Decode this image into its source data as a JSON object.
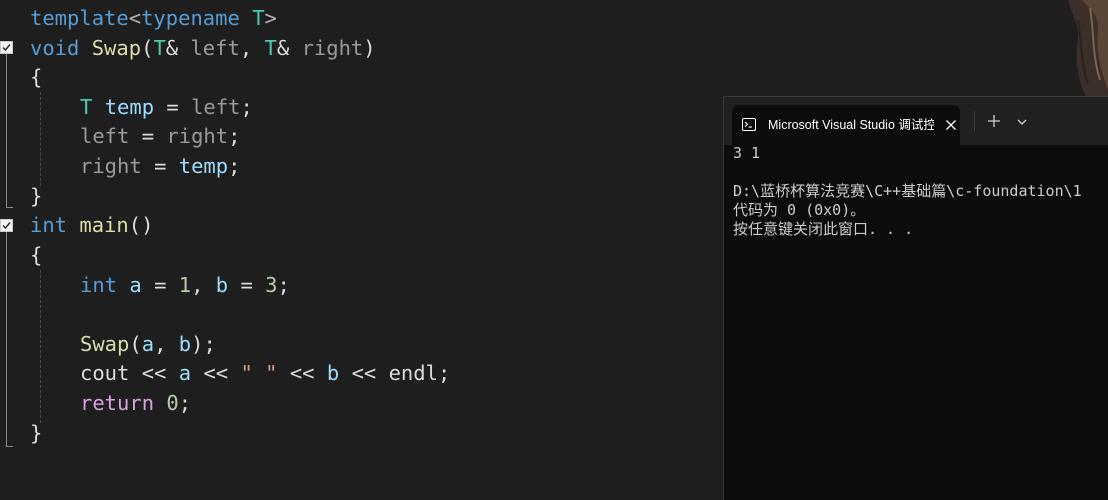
{
  "editor": {
    "lines": {
      "l1": {
        "kw1": "template",
        "lt": "<",
        "kw2": "typename",
        "ty": "T",
        "gt": ">"
      },
      "l2": {
        "kw": "void",
        "fn": "Swap",
        "p1": "(",
        "ty1": "T",
        "amp1": "&",
        "prm1": "left",
        "comma": ",",
        "ty2": "T",
        "amp2": "&",
        "prm2": "right",
        "p2": ")"
      },
      "l3": {
        "brace": "{"
      },
      "l4": {
        "ty": "T",
        "var": "temp",
        "eq": "=",
        "prm": "left",
        "semi": ";"
      },
      "l5": {
        "prm1": "left",
        "eq": "=",
        "prm2": "right",
        "semi": ";"
      },
      "l6": {
        "prm": "right",
        "eq": "=",
        "var": "temp",
        "semi": ";"
      },
      "l7": {
        "brace": "}"
      },
      "l8": {
        "kw": "int",
        "fn": "main",
        "parens": "()"
      },
      "l9": {
        "brace": "{"
      },
      "l10": {
        "kw": "int",
        "v1": "a",
        "eq1": "=",
        "n1": "1",
        "comma": ",",
        "v2": "b",
        "eq2": "=",
        "n2": "3",
        "semi": ";"
      },
      "l12": {
        "fn": "Swap",
        "p1": "(",
        "v1": "a",
        "comma": ",",
        "v2": "b",
        "p2": ")",
        "semi": ";"
      },
      "l13": {
        "id1": "cout",
        "op1": "<<",
        "v1": "a",
        "op2": "<<",
        "str": "\" \"",
        "op3": "<<",
        "v2": "b",
        "op4": "<<",
        "id2": "endl",
        "semi": ";"
      },
      "l14": {
        "kw": "return",
        "num": "0",
        "semi": ";"
      },
      "l15": {
        "brace": "}"
      }
    },
    "colors": {
      "background": "#1e1e1e",
      "keyword": "#569cd6",
      "type": "#4ec9b0",
      "function": "#dcdcaa",
      "variable": "#9cdcfe",
      "parameter": "#9a9a9a",
      "number": "#b5cea8",
      "string": "#d69d85",
      "control": "#d8a0df"
    }
  },
  "terminal": {
    "tab_icon": "console-icon",
    "tab_title": "Microsoft Visual Studio 调试控",
    "close_icon": "close-icon",
    "new_tab_icon": "plus-icon",
    "dropdown_icon": "chevron-down-icon",
    "output": [
      "3 1",
      "",
      "D:\\蓝桥杯算法竞赛\\C++基础篇\\c-foundation\\1",
      "代码为 0 (0x0)。",
      "按任意键关闭此窗口. . ."
    ],
    "colors": {
      "background": "#0c0c0c",
      "tab_bar": "#202020",
      "text": "#cccccc"
    }
  }
}
